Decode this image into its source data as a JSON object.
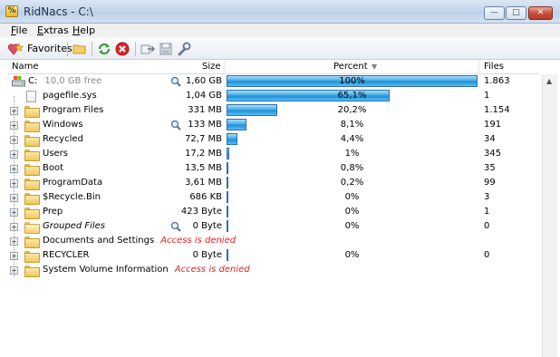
{
  "window": {
    "title": "RidNacs - C:\\"
  },
  "menu": [
    {
      "underline": "F",
      "rest": "ile"
    },
    {
      "underline": "E",
      "rest": "xtras"
    },
    {
      "underline": "H",
      "rest": "elp"
    }
  ],
  "toolbar": {
    "favorites_label": "Favorites"
  },
  "columns": {
    "name": "Name",
    "size": "Size",
    "percent": "Percent",
    "files": "Files"
  },
  "drive": {
    "name": "C:",
    "free": "10,0 GB free",
    "size": "1,60 GB",
    "percent": "100%",
    "files": "1.863",
    "fill": 1.0
  },
  "rows": [
    {
      "name": "pagefile.sys",
      "type": "file",
      "size": "1,04 GB",
      "percent": "65,1%",
      "files": "1",
      "fill": 0.651
    },
    {
      "name": "Program Files",
      "type": "folder",
      "size": "331 MB",
      "percent": "20,2%",
      "files": "1.154",
      "fill": 0.202
    },
    {
      "name": "Windows",
      "type": "folder",
      "size": "133 MB",
      "percent": "8,1%",
      "files": "191",
      "fill": 0.081,
      "magnifier": true
    },
    {
      "name": "Recycled",
      "type": "folder",
      "size": "72,7 MB",
      "percent": "4,4%",
      "files": "34",
      "fill": 0.044
    },
    {
      "name": "Users",
      "type": "folder",
      "size": "17,2 MB",
      "percent": "1%",
      "files": "345",
      "fill": 0.01
    },
    {
      "name": "Boot",
      "type": "folder",
      "size": "13,5 MB",
      "percent": "0,8%",
      "files": "35",
      "fill": 0.008
    },
    {
      "name": "ProgramData",
      "type": "folder",
      "size": "3,61 MB",
      "percent": "0,2%",
      "files": "99",
      "fill": 0.002
    },
    {
      "name": "$Recycle.Bin",
      "type": "folder",
      "size": "686 KB",
      "percent": "0%",
      "files": "3",
      "fill": 0
    },
    {
      "name": "Prep",
      "type": "folder",
      "size": "423 Byte",
      "percent": "0%",
      "files": "1",
      "fill": 0
    },
    {
      "name": "Grouped Files",
      "type": "grouped",
      "size": "0 Byte",
      "percent": "0%",
      "files": "0",
      "fill": 0,
      "magnifier": true
    },
    {
      "name": "Documents and Settings",
      "type": "folder",
      "denied": "Access is denied",
      "size": "",
      "percent": "",
      "files": "",
      "fill": 0
    },
    {
      "name": "RECYCLER",
      "type": "folder",
      "size": "0 Byte",
      "percent": "0%",
      "files": "0",
      "fill": 0
    },
    {
      "name": "System Volume Information",
      "type": "folder",
      "denied": "Access is denied",
      "size": "",
      "percent": "",
      "files": "",
      "fill": 0
    }
  ]
}
